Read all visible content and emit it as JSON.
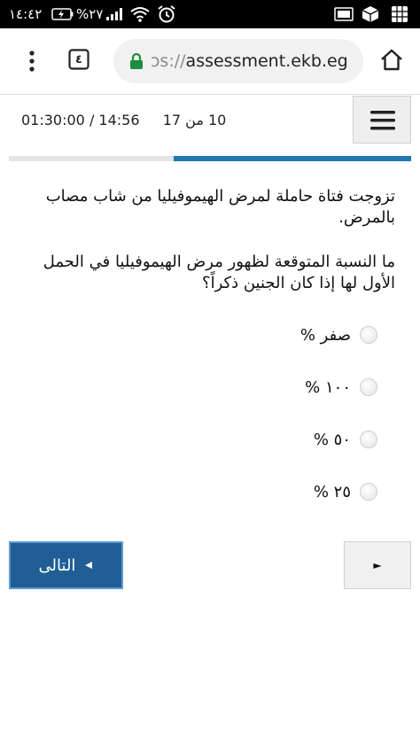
{
  "status_bar": {
    "time": "١٤:٤٢",
    "battery": "%٢٧",
    "icons": [
      "battery-charging-icon",
      "signal-icon",
      "wifi-icon",
      "alarm-icon",
      "screenshot-icon",
      "package-icon",
      "grid-icon"
    ]
  },
  "browser": {
    "tab_count": "٤",
    "url_faded": "ɔs://",
    "url_main": "assessment.ekb.eg",
    "icons": [
      "more-vertical-icon",
      "tabs-icon",
      "lock-icon",
      "home-icon"
    ],
    "lock_color": "#1e8e3e"
  },
  "quiz": {
    "timer": "01:30:00 / 14:56",
    "question_counter": "10 من 17",
    "progress_fraction": 0.59,
    "accent_color": "#1f78b4",
    "question_intro": "تزوجت فتاة حاملة لمرض الهيموفيليا من شاب مصاب بالمرض.",
    "question_text": "ما النسبة المتوقعة لظهور مرض الهيموفيليا في الحمل الأول لها إذا كان الجنين ذكراً؟",
    "options": [
      "صفر %",
      "١٠٠ %",
      "٥٠ %",
      "٢٥ %"
    ],
    "next_label": "التالى",
    "prev_symbol": "►"
  }
}
